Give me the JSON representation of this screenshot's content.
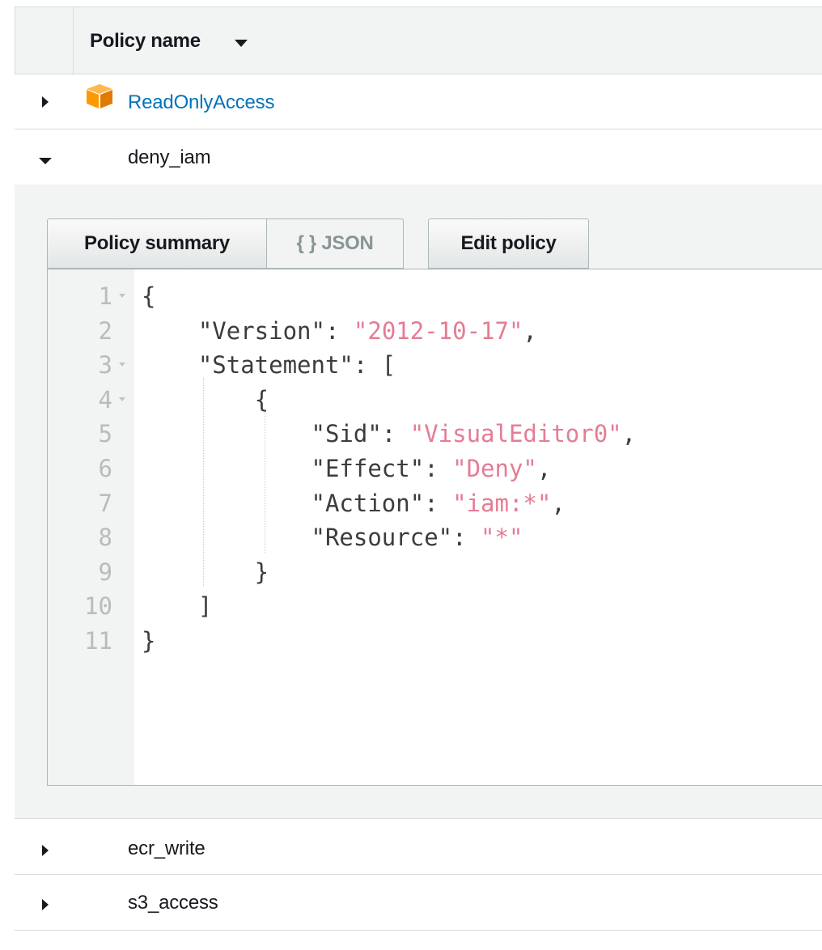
{
  "table": {
    "column_header": "Policy name",
    "sort_icon": "caret-down-icon"
  },
  "rows": [
    {
      "name": "ReadOnlyAccess",
      "aws_managed": true,
      "expanded": false,
      "icon": "aws-cube-icon"
    },
    {
      "name": "deny_iam",
      "aws_managed": false,
      "expanded": true
    },
    {
      "name": "ecr_write",
      "aws_managed": false,
      "expanded": false
    },
    {
      "name": "s3_access",
      "aws_managed": false,
      "expanded": false
    }
  ],
  "panel": {
    "buttons": {
      "summary": "Policy summary",
      "json": "{ } JSON",
      "edit": "Edit policy"
    },
    "active_tab": "json",
    "editor": {
      "lines": [
        {
          "n": "1",
          "fold": true,
          "parts": [
            {
              "t": "{",
              "s": false
            }
          ]
        },
        {
          "n": "2",
          "fold": false,
          "parts": [
            {
              "t": "    \"Version\": ",
              "s": false
            },
            {
              "t": "\"2012-10-17\"",
              "s": true
            },
            {
              "t": ",",
              "s": false
            }
          ]
        },
        {
          "n": "3",
          "fold": true,
          "parts": [
            {
              "t": "    \"Statement\": [",
              "s": false
            }
          ]
        },
        {
          "n": "4",
          "fold": true,
          "parts": [
            {
              "t": "        {",
              "s": false
            }
          ]
        },
        {
          "n": "5",
          "fold": false,
          "parts": [
            {
              "t": "            \"Sid\": ",
              "s": false
            },
            {
              "t": "\"VisualEditor0\"",
              "s": true
            },
            {
              "t": ",",
              "s": false
            }
          ]
        },
        {
          "n": "6",
          "fold": false,
          "parts": [
            {
              "t": "            \"Effect\": ",
              "s": false
            },
            {
              "t": "\"Deny\"",
              "s": true
            },
            {
              "t": ",",
              "s": false
            }
          ]
        },
        {
          "n": "7",
          "fold": false,
          "parts": [
            {
              "t": "            \"Action\": ",
              "s": false
            },
            {
              "t": "\"iam:*\"",
              "s": true
            },
            {
              "t": ",",
              "s": false
            }
          ]
        },
        {
          "n": "8",
          "fold": false,
          "parts": [
            {
              "t": "            \"Resource\": ",
              "s": false
            },
            {
              "t": "\"*\"",
              "s": true
            }
          ]
        },
        {
          "n": "9",
          "fold": false,
          "parts": [
            {
              "t": "        }",
              "s": false
            }
          ]
        },
        {
          "n": "10",
          "fold": false,
          "parts": [
            {
              "t": "    ]",
              "s": false
            }
          ]
        },
        {
          "n": "11",
          "fold": false,
          "parts": [
            {
              "t": "}",
              "s": false
            }
          ]
        }
      ]
    }
  },
  "colors": {
    "link": "#0073bb",
    "string": "#e57c94",
    "header_bg": "#f2f3f3",
    "aws_orange": "#f90"
  }
}
